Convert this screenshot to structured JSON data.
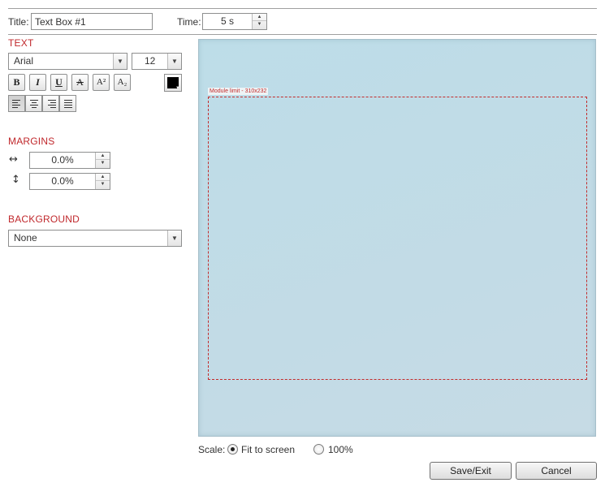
{
  "header": {
    "title_label": "Title:",
    "title_value": "Text Box #1",
    "time_label": "Time:",
    "time_value": "5 s"
  },
  "text_section": {
    "heading": "TEXT",
    "font_family": "Arial",
    "font_size": "12",
    "style_buttons": [
      {
        "name": "bold",
        "glyph": "B"
      },
      {
        "name": "italic",
        "glyph": "I"
      },
      {
        "name": "underline",
        "glyph": "U"
      },
      {
        "name": "strikethrough",
        "glyph": "A"
      },
      {
        "name": "superscript",
        "glyph": "A²"
      },
      {
        "name": "subscript",
        "glyph": "A₂"
      }
    ],
    "text_color": "#000000",
    "alignment": "left"
  },
  "margins_section": {
    "heading": "MARGINS",
    "horizontal_value": "0.0%",
    "vertical_value": "0.0%"
  },
  "background_section": {
    "heading": "BACKGROUND",
    "value": "None"
  },
  "preview": {
    "module_limit_label": "Module limit - 310x232",
    "background_color": "#c0dbe6",
    "limit_color": "#c32b2b"
  },
  "scale": {
    "label": "Scale:",
    "fit_label": "Fit to screen",
    "full_label": "100%",
    "selected": "fit"
  },
  "actions": {
    "save_label": "Save/Exit",
    "cancel_label": "Cancel"
  }
}
